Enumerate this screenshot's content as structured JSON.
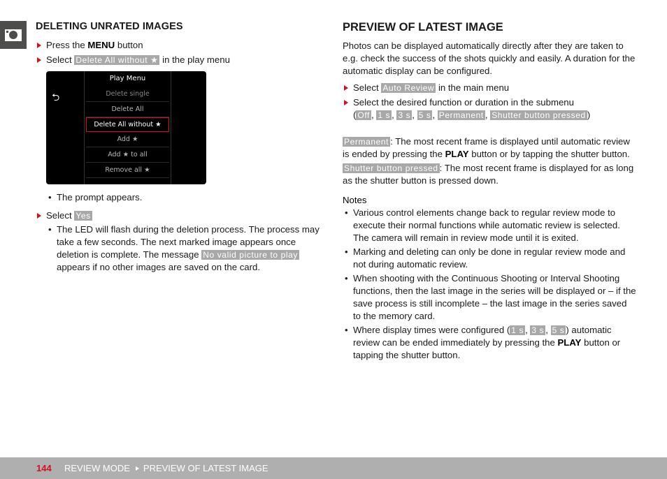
{
  "side_tab": {
    "icon": "camera-icon"
  },
  "left": {
    "heading": "DELETING UNRATED IMAGES",
    "step1": {
      "pre": "Press the ",
      "key": "MENU",
      "post": " button"
    },
    "step2": {
      "pre": "Select ",
      "chip": "Delete All without ★",
      "post": " in the play menu"
    },
    "screen": {
      "back_icon": "back-arrow-icon",
      "title": "Play Menu",
      "items": [
        {
          "label": "Delete single",
          "state": "dim"
        },
        {
          "label": "Delete All",
          "state": "light"
        },
        {
          "label": "Delete All without ★",
          "state": "selected"
        },
        {
          "label": "Add ★",
          "state": "light"
        },
        {
          "label": "Add ★ to all",
          "state": "light"
        },
        {
          "label": "Remove all ★",
          "state": "light"
        }
      ]
    },
    "note1": "The prompt appears.",
    "step3": {
      "pre": "Select ",
      "chip": "Yes"
    },
    "note2": {
      "pre": "The LED will flash during the deletion process. The process may take a few seconds. The next marked image appears once deletion is complete. The message ",
      "chip": "No valid picture to play",
      "post": " appears if no other images are saved on the card."
    }
  },
  "right": {
    "heading": "PREVIEW OF LATEST IMAGE",
    "intro": "Photos can be displayed automatically directly after they are taken to e.g. check the success of the shots quickly and easily. A duration for the automatic display can be configured.",
    "step1": {
      "pre": "Select ",
      "chip": "Auto Review",
      "post": " in the main menu"
    },
    "step2": {
      "text": "Select the desired function or duration in the submenu",
      "options": [
        "Off",
        "1 s",
        "3 s",
        "5 s",
        "Permanent",
        "Shutter button pressed"
      ]
    },
    "desc_permanent": {
      "chip": "Permanent",
      "pre": ": The most recent frame is displayed until automatic review is ended by pressing the ",
      "key": "PLAY",
      "post": " button or by tapping the shutter button."
    },
    "desc_shutter": {
      "chip": "Shutter button pressed",
      "text": ": The most recent frame is displayed for as long as the shutter button is pressed down."
    },
    "notes_heading": "Notes",
    "notes": [
      "Various control elements change back to regular review mode to execute their normal functions while automatic review is selected. The camera will remain in review mode until it is exited.",
      "Marking and deleting can only be done in regular review mode and not during automatic review.",
      "When shooting with the Continuous Shooting or Interval Shooting functions, then the last image in the series will be displayed or – if the save process is still incomplete – the last image in the series saved to the memory card."
    ],
    "note4": {
      "pre": "Where display times were configured (",
      "chips": [
        "1 s",
        "3 s",
        "5 s"
      ],
      "mid": ") automatic review can be ended immediately by pressing the ",
      "key": "PLAY",
      "post": " button or tapping the shutter button."
    }
  },
  "footer": {
    "page_number": "144",
    "crumb1": "REVIEW MODE",
    "crumb2": "PREVIEW OF LATEST IMAGE"
  },
  "colors": {
    "accent_red": "#d4101e",
    "chip_gray": "#a8a8a8",
    "footer_gray": "#afafaf",
    "tab_dark": "#4d4d4b"
  }
}
